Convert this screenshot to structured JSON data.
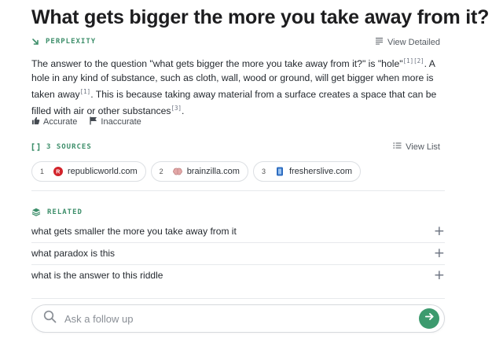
{
  "page": {
    "title": "What gets bigger the more you take away from it?"
  },
  "answer": {
    "section_label": "PERPLEXITY",
    "view_detailed_label": "View Detailed",
    "text_part1": "The answer to the question \"what gets bigger the more you take away from it?\" is \"hole\"",
    "cite_a": "[1][2]",
    "text_part2": ". A hole in any kind of substance, such as cloth, wall, wood or ground, will get bigger when more is taken away",
    "cite_b": "[1]",
    "text_part3": ". This is because taking away material from a surface creates a space that can be filled with air or other substances",
    "cite_c": "[3]",
    "text_part4": ".",
    "feedback": {
      "accurate_label": "Accurate",
      "inaccurate_label": "Inaccurate"
    }
  },
  "sources": {
    "section_label": "3 SOURCES",
    "view_list_label": "View List",
    "items": [
      {
        "num": "1",
        "domain": "republicworld.com",
        "icon": "republicworld-favicon",
        "color": "#d2232a"
      },
      {
        "num": "2",
        "domain": "brainzilla.com",
        "icon": "brain-favicon",
        "color": "#c98a8a"
      },
      {
        "num": "3",
        "domain": "fresherslive.com",
        "icon": "fresherslive-favicon",
        "color": "#2d6cc0"
      }
    ]
  },
  "related": {
    "section_label": "RELATED",
    "items": [
      {
        "text": "what gets smaller the more you take away from it"
      },
      {
        "text": "what paradox is this"
      },
      {
        "text": "what is the answer to this riddle"
      }
    ]
  },
  "followup": {
    "placeholder": "Ask a follow up"
  },
  "colors": {
    "accent": "#3c9a6e",
    "section_label": "#3e8f6b"
  }
}
